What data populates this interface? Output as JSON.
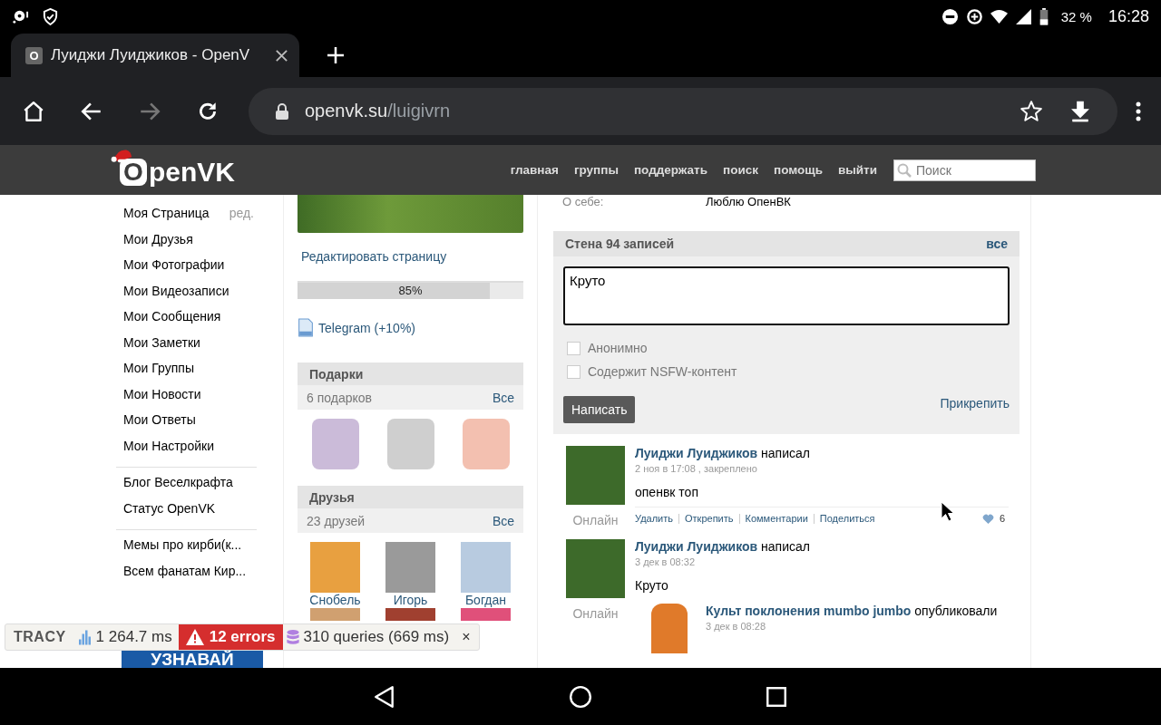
{
  "status_bar": {
    "battery": "32 %",
    "time": "16:28"
  },
  "browser": {
    "tab": {
      "title": "Луиджи Луиджиков - OpenV",
      "favicon": "O"
    },
    "url": {
      "host": "openvk.su",
      "path": "/luigivrn"
    }
  },
  "site_header": {
    "logo_letter": "O",
    "logo_rest": "penVK",
    "nav": [
      "главная",
      "группы",
      "поддержать",
      "поиск",
      "помощь",
      "выйти"
    ],
    "search": {
      "placeholder": "Поиск"
    }
  },
  "sidebar": {
    "groups": [
      [
        {
          "label": "Моя Страница",
          "extra": "ред."
        },
        {
          "label": "Мои Друзья"
        },
        {
          "label": "Мои Фотографии"
        },
        {
          "label": "Мои Видеозаписи"
        },
        {
          "label": "Мои Сообщения"
        },
        {
          "label": "Мои Заметки"
        },
        {
          "label": "Мои Группы"
        },
        {
          "label": "Мои Новости"
        },
        {
          "label": "Мои Ответы"
        },
        {
          "label": "Мои Настройки"
        }
      ],
      [
        {
          "label": "Блог Веселкрафта"
        },
        {
          "label": "Статус OpenVK"
        }
      ],
      [
        {
          "label": "Мемы про кирби(к..."
        },
        {
          "label": "Всем фанатам Кир..."
        }
      ]
    ],
    "ad_banner": "УЗНАВАЙ"
  },
  "profile": {
    "edit_link": "Редактировать страницу",
    "completion": {
      "level": 0.85,
      "reading": "85%"
    },
    "telegram_link": "Telegram (+10%)",
    "gifts": {
      "title": "Подарки",
      "count": "6 подарков",
      "all": "Все"
    },
    "friends": {
      "title": "Друзья",
      "count": "23 друзей",
      "all": "Все",
      "names": [
        "Снобель",
        "Игорь",
        "Богдан"
      ]
    }
  },
  "about": {
    "label": "О себе:",
    "value": "Люблю ОпенВК"
  },
  "wall": {
    "title": "Стена 94 записей",
    "all": "все",
    "composer": {
      "value": "Круто"
    },
    "options": [
      {
        "label": "Анонимно",
        "checked": false
      },
      {
        "label": "Содержит NSFW-контент",
        "checked": false
      }
    ],
    "submit": "Написать",
    "attach": "Прикрепить"
  },
  "posts": [
    {
      "author": "Луиджи Луиджиков",
      "verb": "написал",
      "date": "2 ноя в 17:08 , закреплено",
      "text": "опенвк топ",
      "status": "Онлайн",
      "actions": [
        "Удалить",
        "Открепить",
        "Комментарии",
        "Поделиться"
      ],
      "likes": "6"
    },
    {
      "author": "Луиджи Луиджиков",
      "verb": "написал",
      "date": "3 дек в 08:32",
      "text": "Круто",
      "status": "Онлайн",
      "repost": {
        "author": "Культ поклонения mumbo jumbo",
        "verb": "опубликовали",
        "date": "3 дек в 08:28"
      }
    }
  ],
  "debug_bar": {
    "brand": "TRACY",
    "time": "1 264.7 ms",
    "errors": "12 errors",
    "queries": "310 queries (669 ms)",
    "close": "×"
  }
}
